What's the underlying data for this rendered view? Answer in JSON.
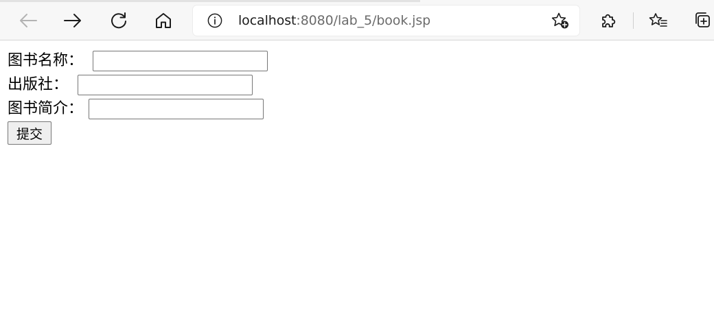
{
  "browser": {
    "url_host": "localhost",
    "url_rest": ":8080/lab_5/book.jsp",
    "icons": {
      "back": "back-arrow-icon",
      "forward": "forward-arrow-icon",
      "refresh": "refresh-icon",
      "home": "home-icon",
      "info": "info-icon",
      "add_favorite": "add-favorite-star-icon",
      "extensions": "puzzle-icon",
      "favorites": "favorites-list-icon",
      "collections": "collections-icon"
    },
    "colors": {
      "toolbar_bg": "#f7f7f7",
      "icon_active": "#1b1b1b",
      "icon_disabled": "#b3b3b3"
    }
  },
  "form": {
    "fields": [
      {
        "label": "图书名称：",
        "value": ""
      },
      {
        "label": "出版社：",
        "value": ""
      },
      {
        "label": "图书简介：",
        "value": ""
      }
    ],
    "submit_label": "提交"
  }
}
